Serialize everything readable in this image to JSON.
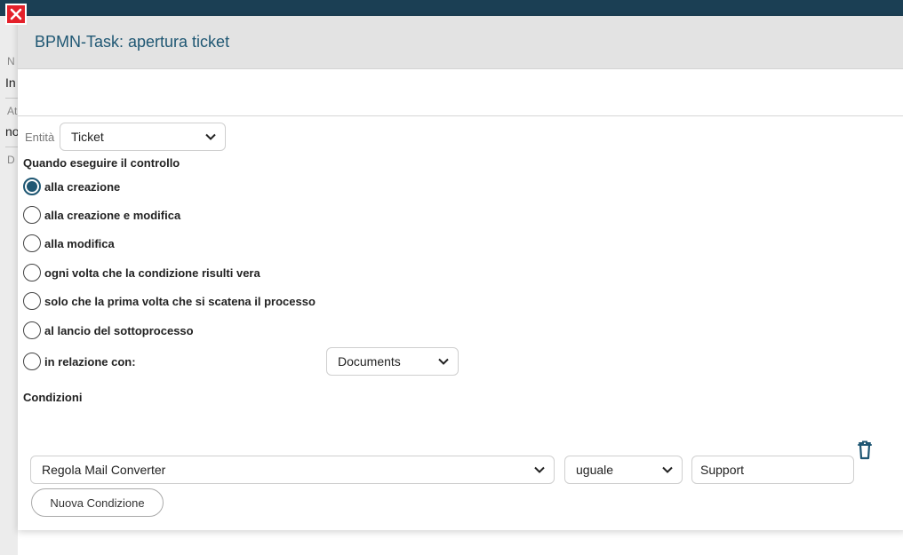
{
  "background": {
    "labels": [
      {
        "label": "N",
        "value": "In"
      },
      {
        "label": "At",
        "value": "no"
      },
      {
        "label": "D",
        "value": ""
      }
    ]
  },
  "close_icon": "close-icon",
  "modal": {
    "title": "BPMN-Task: apertura ticket",
    "entity": {
      "label": "Entità",
      "value": "Ticket"
    },
    "when": {
      "heading": "Quando eseguire il controllo",
      "options": [
        {
          "label": "alla creazione",
          "checked": true
        },
        {
          "label": "alla creazione e modifica",
          "checked": false
        },
        {
          "label": "alla modifica",
          "checked": false
        },
        {
          "label": "ogni volta che la condizione risulti vera",
          "checked": false
        },
        {
          "label": "solo che la prima volta che si scatena il processo",
          "checked": false
        },
        {
          "label": "al lancio del sottoprocesso",
          "checked": false
        },
        {
          "label": "in relazione con:",
          "checked": false
        }
      ],
      "relation_select": "Documents"
    },
    "conditions": {
      "heading": "Condizioni",
      "rows": [
        {
          "field": "Regola Mail Converter",
          "operator": "uguale",
          "value": "Support"
        }
      ],
      "delete_icon": "trash-icon",
      "add_button": "Nuova Condizione"
    }
  },
  "colors": {
    "accent": "#1f5773",
    "header_bg": "#e3e3e3",
    "topbar": "#1b3f54",
    "close": "#e4202a"
  }
}
